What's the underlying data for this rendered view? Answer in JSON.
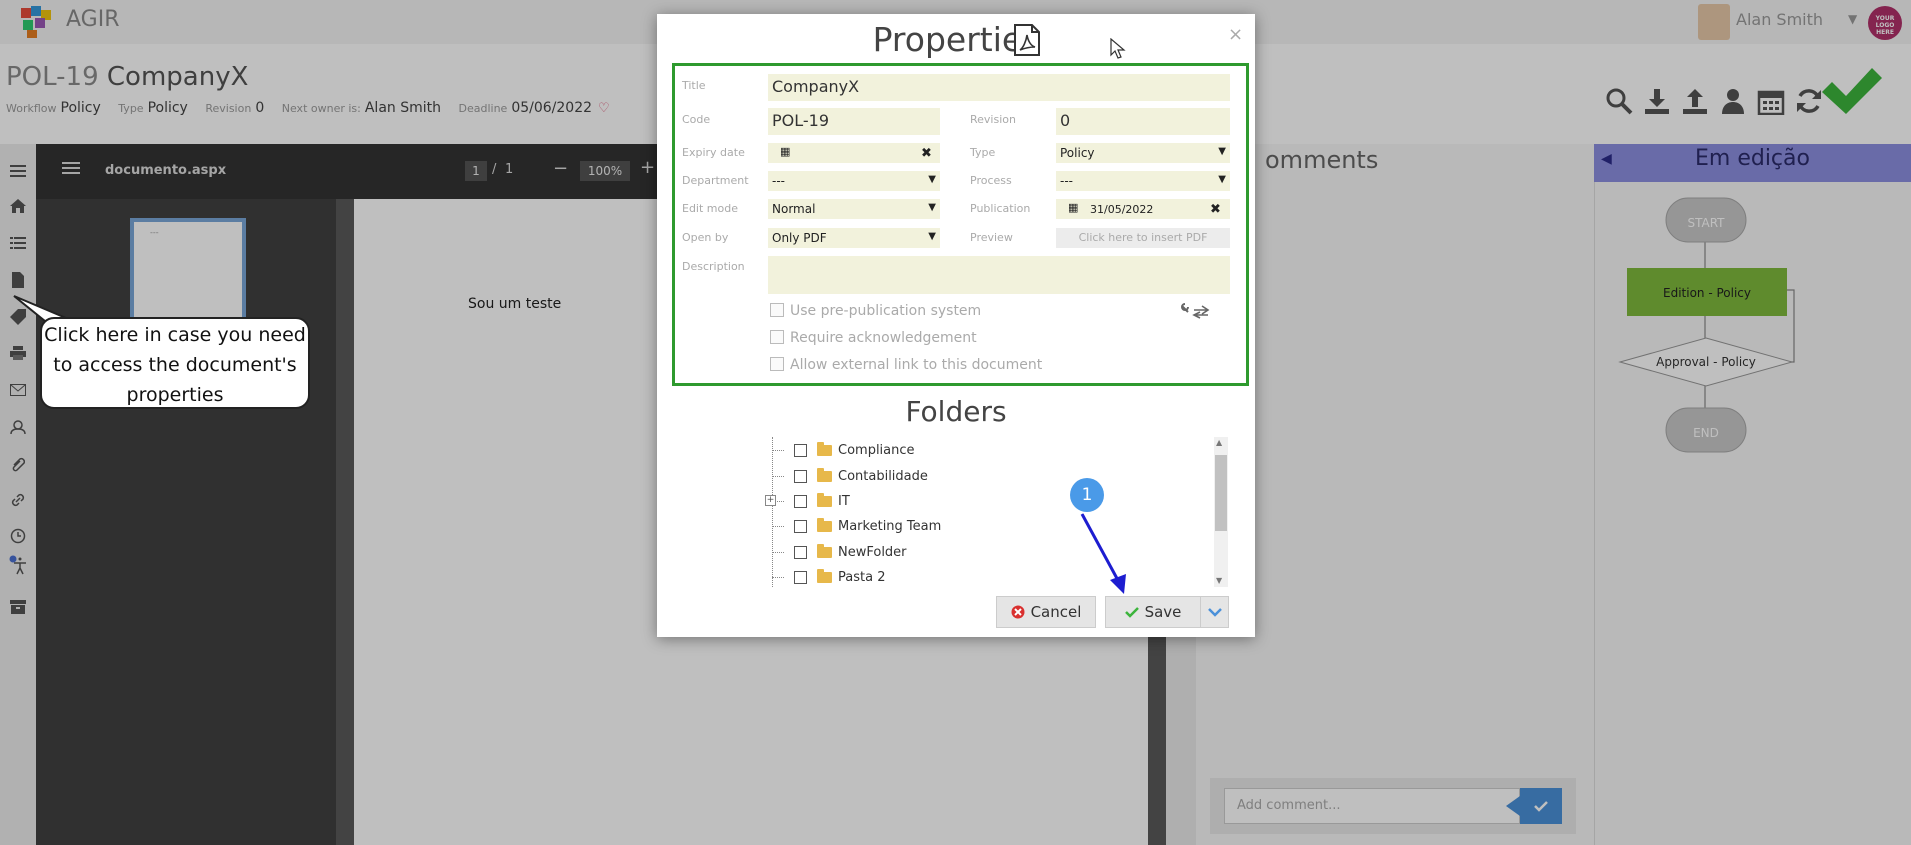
{
  "app": {
    "name": "AGIR",
    "user_name": "Alan Smith",
    "company_logo_text": "YOUR LOGO HERE"
  },
  "document": {
    "code": "POL-19",
    "name": "CompanyX",
    "meta": {
      "workflow_label": "Workflow",
      "workflow_value": "Policy",
      "type_label": "Type",
      "type_value": "Policy",
      "revision_label": "Revision",
      "revision_value": "0",
      "next_owner_label": "Next owner is:",
      "next_owner_value": "Alan Smith",
      "deadline_label": "Deadline",
      "deadline_value": "05/06/2022"
    }
  },
  "toolbar_icons": [
    "search-icon",
    "download-icon",
    "upload-icon",
    "user-icon",
    "calendar-icon",
    "refresh-icon",
    "approve-check-icon"
  ],
  "left_rail_icons": [
    "menu-icon",
    "home-icon",
    "list-icon",
    "document-icon",
    "tag-icon",
    "print-icon",
    "mail-icon",
    "users-icon",
    "attachment-icon",
    "link-icon",
    "clock-icon",
    "accessibility-icon",
    "archive-icon"
  ],
  "pdf_viewer": {
    "filename": "documento.aspx",
    "page_current": "1",
    "page_sep": "/",
    "page_total": "1",
    "zoom": "100%",
    "zoom_out": "−",
    "zoom_in": "+",
    "thumb_text": "---",
    "page_text": "Sou um teste"
  },
  "comments": {
    "title": "omments",
    "placeholder": "Add comment..."
  },
  "workflow": {
    "title": "Em edição",
    "nodes": {
      "start": "START",
      "edition": "Edition - Policy",
      "approval": "Approval - Policy",
      "end": "END"
    }
  },
  "callout": {
    "text": "Click here in case you need to access the document's properties"
  },
  "modal": {
    "title": "Properties",
    "close": "×",
    "fields": {
      "title_label": "Title",
      "title_value": "CompanyX",
      "code_label": "Code",
      "code_value": "POL-19",
      "revision_label": "Revision",
      "revision_value": "0",
      "expiry_label": "Expiry date",
      "expiry_value": "",
      "type_label": "Type",
      "type_value": "Policy",
      "department_label": "Department",
      "department_value": "---",
      "process_label": "Process",
      "process_value": "---",
      "edit_mode_label": "Edit mode",
      "edit_mode_value": "Normal",
      "publication_label": "Publication",
      "publication_value": "31/05/2022",
      "open_by_label": "Open by",
      "open_by_value": "Only PDF",
      "preview_label": "Preview",
      "preview_value": "Click here to insert PDF",
      "description_label": "Description",
      "description_value": ""
    },
    "checkboxes": {
      "pre_publication": "Use pre-publication system",
      "require_ack": "Require acknowledgement",
      "external_link": "Allow external link to this document"
    },
    "folders_title": "Folders",
    "folders": [
      "Compliance",
      "Contabilidade",
      "IT",
      "Marketing Team",
      "NewFolder",
      "Pasta 2"
    ],
    "cancel_label": "Cancel",
    "save_label": "Save",
    "step_number": "1"
  },
  "colors": {
    "accent_green": "#2e9a2e",
    "workflow_header": "#8c8fe0",
    "edition_node": "#7fba3c",
    "step_badge": "#4a9ae8",
    "arrow": "#1d1dd0"
  }
}
